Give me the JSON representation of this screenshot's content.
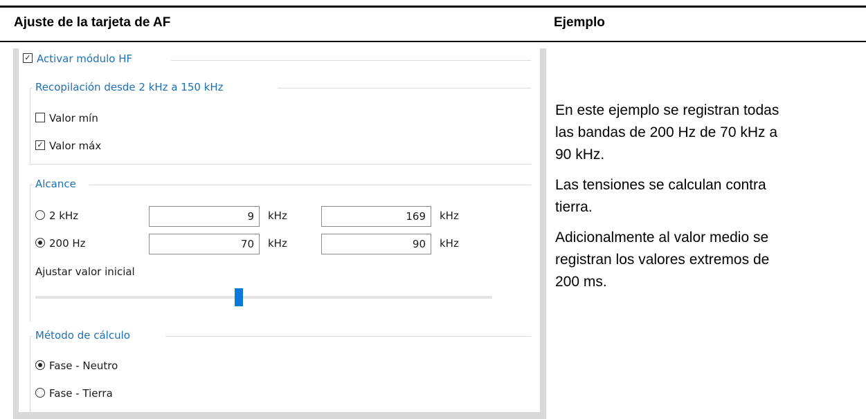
{
  "header": {
    "left_title": "Ajuste de la tarjeta de AF",
    "right_title": "Ejemplo"
  },
  "screenshot": {
    "activate_module": {
      "label": "Activar módulo HF",
      "checked": true
    },
    "collection": {
      "title": "Recopilación desde 2 kHz a 150 kHz",
      "min": {
        "label": "Valor mín",
        "checked": false
      },
      "max": {
        "label": "Valor máx",
        "checked": true
      }
    },
    "range": {
      "title": "Alcance",
      "rows": [
        {
          "label": "2 kHz",
          "selected": false,
          "from": "9",
          "to": "169",
          "unit": "kHz"
        },
        {
          "label": "200 Hz",
          "selected": true,
          "from": "70",
          "to": "90",
          "unit": "kHz"
        }
      ],
      "initial_value_label": "Ajustar valor inicial"
    },
    "method": {
      "title": "Método de cálculo",
      "options": [
        {
          "label": "Fase - Neutro",
          "selected": true
        },
        {
          "label": "Fase - Tierra",
          "selected": false
        }
      ]
    },
    "colors": {
      "accent": "#1c6fb8",
      "slider_thumb": "#0a78d7"
    }
  },
  "example": {
    "paragraphs": [
      [
        "En este ejemplo se registran todas",
        "las bandas de 200 Hz de 70 kHz a",
        "90 kHz."
      ],
      [
        "Las tensiones se calculan contra",
        "tierra."
      ],
      [
        "Adicionalmente al valor medio se",
        "registran los valores extremos de",
        "200 ms."
      ]
    ]
  }
}
